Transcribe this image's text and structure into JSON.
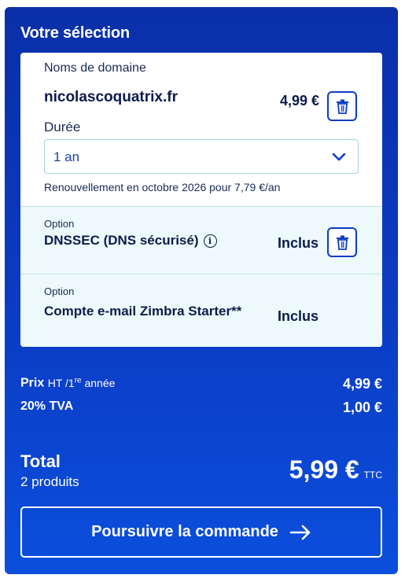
{
  "title": "Votre sélection",
  "domain_section": {
    "label": "Noms de domaine",
    "domain_name": "nicolascoquatrix.fr",
    "price": "4,99 €",
    "duration_label": "Durée",
    "duration_value": "1 an",
    "renewal_text": "Renouvellement en octobre 2026 pour 7,79 €/an"
  },
  "options": [
    {
      "small_label": "Option",
      "name": "DNSSEC (DNS sécurisé)",
      "status": "Inclus",
      "info": "i"
    },
    {
      "small_label": "Option",
      "name": "Compte e-mail Zimbra Starter**",
      "status": "Inclus"
    }
  ],
  "summary": {
    "prix_label": "Prix",
    "prix_ht": "HT /1",
    "prix_sup": "re",
    "prix_year": " année",
    "prix_value": "4,99 €",
    "tva_label": "20% TVA",
    "tva_value": "1,00 €",
    "total_label": "Total",
    "product_count": "2 produits",
    "total_value": "5,99 €",
    "total_suffix": "TTC"
  },
  "cta_label": "Poursuivre la commande",
  "icons": {
    "delete": "trash-icon",
    "dropdown": "chevron-down-icon",
    "info": "info-icon",
    "arrow": "arrow-right-icon"
  },
  "colors": {
    "panel_blue": "#0b3cc4",
    "card_bg": "#ffffff",
    "option_bg": "#eef9fb",
    "text_dark": "#0c1b4a"
  }
}
